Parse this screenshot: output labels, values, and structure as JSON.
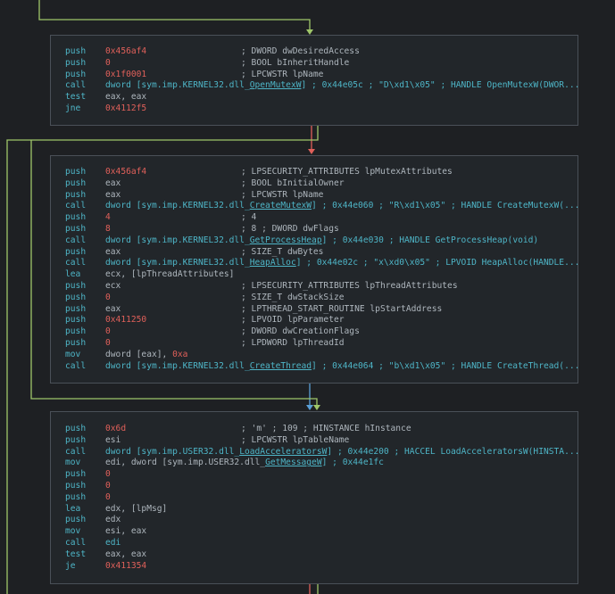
{
  "blocks": [
    {
      "id": "block1",
      "lines": [
        {
          "m": "push",
          "o": [
            {
              "t": "0x456af4",
              "c": "red"
            }
          ],
          "c": "; DWORD dwDesiredAccess"
        },
        {
          "m": "push",
          "o": [
            {
              "t": "0",
              "c": "red"
            }
          ],
          "c": "; BOOL bInheritHandle"
        },
        {
          "m": "push",
          "o": [
            {
              "t": "0x1f0001",
              "c": "red"
            }
          ],
          "c": "; LPCWSTR lpName"
        },
        {
          "m": "call",
          "o": [
            {
              "t": "dword [sym.imp.KERNEL32.dll_",
              "c": "teal"
            },
            {
              "t": "OpenMutexW",
              "c": "teal",
              "u": true
            },
            {
              "t": "] ; 0x44e05c ; \"D\\xd1\\x05\" ; HANDLE OpenMutexW(DWOR...",
              "c": "teal"
            }
          ],
          "c": ""
        },
        {
          "m": "test",
          "o": [
            {
              "t": "eax, eax",
              "c": ""
            }
          ],
          "c": ""
        },
        {
          "m": "jne",
          "o": [
            {
              "t": "0x4112f5",
              "c": "red"
            }
          ],
          "c": ""
        }
      ]
    },
    {
      "id": "block2",
      "lines": [
        {
          "m": "push",
          "o": [
            {
              "t": "0x456af4",
              "c": "red"
            }
          ],
          "c": "; LPSECURITY_ATTRIBUTES lpMutexAttributes"
        },
        {
          "m": "push",
          "o": [
            {
              "t": "eax",
              "c": ""
            }
          ],
          "c": "; BOOL bInitialOwner"
        },
        {
          "m": "push",
          "o": [
            {
              "t": "eax",
              "c": ""
            }
          ],
          "c": "; LPCWSTR lpName"
        },
        {
          "m": "call",
          "o": [
            {
              "t": "dword [sym.imp.KERNEL32.dll_",
              "c": "teal"
            },
            {
              "t": "CreateMutexW",
              "c": "teal",
              "u": true
            },
            {
              "t": "] ; 0x44e060 ; \"R\\xd1\\x05\" ; HANDLE CreateMutexW(...",
              "c": "teal"
            }
          ],
          "c": ""
        },
        {
          "m": "push",
          "o": [
            {
              "t": "4",
              "c": "red"
            }
          ],
          "c": "; 4"
        },
        {
          "m": "push",
          "o": [
            {
              "t": "8",
              "c": "red"
            }
          ],
          "c": "; 8 ; DWORD dwFlags"
        },
        {
          "m": "call",
          "o": [
            {
              "t": "dword [sym.imp.KERNEL32.dll_",
              "c": "teal"
            },
            {
              "t": "GetProcessHeap",
              "c": "teal",
              "u": true
            },
            {
              "t": "] ; 0x44e030 ; HANDLE GetProcessHeap(void)",
              "c": "teal"
            }
          ],
          "c": ""
        },
        {
          "m": "push",
          "o": [
            {
              "t": "eax",
              "c": ""
            }
          ],
          "c": "; SIZE_T dwBytes"
        },
        {
          "m": "call",
          "o": [
            {
              "t": "dword [sym.imp.KERNEL32.dll_",
              "c": "teal"
            },
            {
              "t": "HeapAlloc",
              "c": "teal",
              "u": true
            },
            {
              "t": "] ; 0x44e02c ; \"x\\xd0\\x05\" ; LPVOID HeapAlloc(HANDLE...",
              "c": "teal"
            }
          ],
          "c": ""
        },
        {
          "m": "lea",
          "o": [
            {
              "t": "ecx, [lpThreadAttributes]",
              "c": ""
            }
          ],
          "c": ""
        },
        {
          "m": "push",
          "o": [
            {
              "t": "ecx",
              "c": ""
            }
          ],
          "c": "; LPSECURITY_ATTRIBUTES lpThreadAttributes"
        },
        {
          "m": "push",
          "o": [
            {
              "t": "0",
              "c": "red"
            }
          ],
          "c": "; SIZE_T dwStackSize"
        },
        {
          "m": "push",
          "o": [
            {
              "t": "eax",
              "c": ""
            }
          ],
          "c": "; LPTHREAD_START_ROUTINE lpStartAddress"
        },
        {
          "m": "push",
          "o": [
            {
              "t": "0x411250",
              "c": "red"
            }
          ],
          "c": "; LPVOID lpParameter"
        },
        {
          "m": "push",
          "o": [
            {
              "t": "0",
              "c": "red"
            }
          ],
          "c": "; DWORD dwCreationFlags"
        },
        {
          "m": "push",
          "o": [
            {
              "t": "0",
              "c": "red"
            }
          ],
          "c": "; LPDWORD lpThreadId"
        },
        {
          "m": "mov",
          "o": [
            {
              "t": "dword [eax], ",
              "c": ""
            },
            {
              "t": "0xa",
              "c": "red"
            }
          ],
          "c": ""
        },
        {
          "m": "call",
          "o": [
            {
              "t": "dword [sym.imp.KERNEL32.dll_",
              "c": "teal"
            },
            {
              "t": "CreateThread",
              "c": "teal",
              "u": true
            },
            {
              "t": "] ; 0x44e064 ; \"b\\xd1\\x05\" ; HANDLE CreateThread(...",
              "c": "teal"
            }
          ],
          "c": ""
        }
      ]
    },
    {
      "id": "block3",
      "lines": [
        {
          "m": "push",
          "o": [
            {
              "t": "0x6d",
              "c": "red"
            }
          ],
          "c": "; 'm' ; 109 ; HINSTANCE hInstance"
        },
        {
          "m": "push",
          "o": [
            {
              "t": "esi",
              "c": ""
            }
          ],
          "c": "; LPCWSTR lpTableName"
        },
        {
          "m": "call",
          "o": [
            {
              "t": "dword [sym.imp.USER32.dll_",
              "c": "teal"
            },
            {
              "t": "LoadAcceleratorsW",
              "c": "teal",
              "u": true
            },
            {
              "t": "] ; 0x44e200 ; HACCEL LoadAcceleratorsW(HINSTA...",
              "c": "teal"
            }
          ],
          "c": ""
        },
        {
          "m": "mov",
          "o": [
            {
              "t": "edi, dword [sym.imp.USER32.dll_",
              "c": ""
            },
            {
              "t": "GetMessageW",
              "c": "teal",
              "u": true
            },
            {
              "t": "] ; 0x44e1fc",
              "c": "teal"
            }
          ],
          "c": ""
        },
        {
          "m": "push",
          "o": [
            {
              "t": "0",
              "c": "red"
            }
          ],
          "c": ""
        },
        {
          "m": "push",
          "o": [
            {
              "t": "0",
              "c": "red"
            }
          ],
          "c": ""
        },
        {
          "m": "push",
          "o": [
            {
              "t": "0",
              "c": "red"
            }
          ],
          "c": ""
        },
        {
          "m": "lea",
          "o": [
            {
              "t": "edx, [lpMsg]",
              "c": ""
            }
          ],
          "c": ""
        },
        {
          "m": "push",
          "o": [
            {
              "t": "edx",
              "c": ""
            }
          ],
          "c": ""
        },
        {
          "m": "mov",
          "o": [
            {
              "t": "esi, eax",
              "c": ""
            }
          ],
          "c": ""
        },
        {
          "m": "call",
          "o": [
            {
              "t": "edi",
              "c": "teal"
            }
          ],
          "c": ""
        },
        {
          "m": "test",
          "o": [
            {
              "t": "eax, eax",
              "c": ""
            }
          ],
          "c": ""
        },
        {
          "m": "je",
          "o": [
            {
              "t": "0x411354",
              "c": "red"
            }
          ],
          "c": ""
        }
      ]
    }
  ],
  "colors": {
    "background": "#1e2023",
    "block_border": "#4a5058",
    "mnemonic": "#4eb5c7",
    "immediate": "#e0605a",
    "edge_true": "#9fc76a",
    "edge_false": "#e0605a",
    "edge_jump": "#5aa0d8"
  }
}
